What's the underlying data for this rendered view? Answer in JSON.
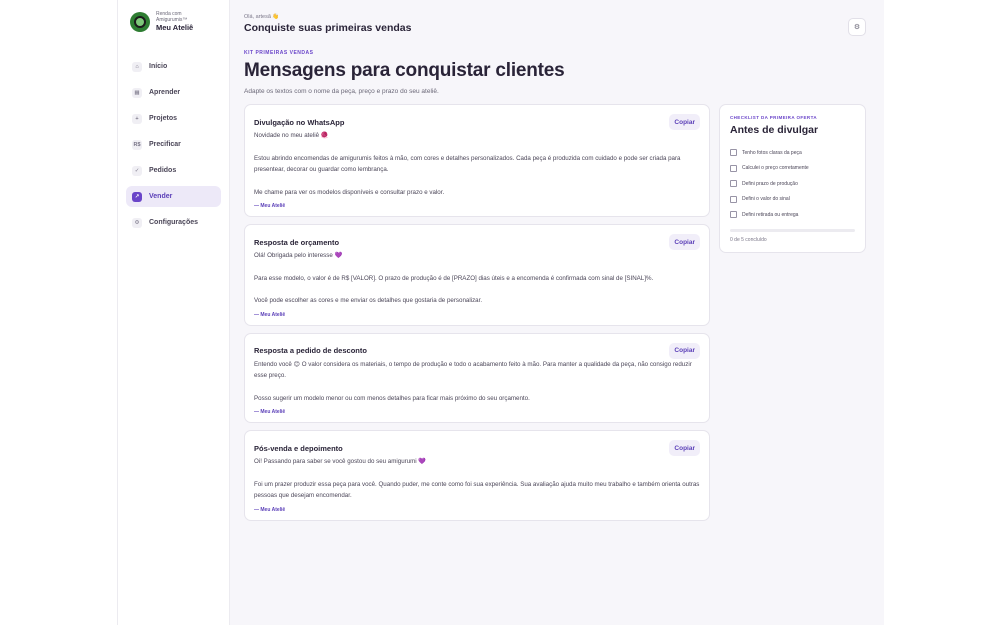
{
  "brand": {
    "line1": "Renda com",
    "line2": "Amigurumis™",
    "name": "Meu Ateliê"
  },
  "nav": [
    {
      "icon": "⌂",
      "label": "Início",
      "active": false
    },
    {
      "icon": "▦",
      "label": "Aprender",
      "active": false
    },
    {
      "icon": "+",
      "label": "Projetos",
      "active": false
    },
    {
      "icon": "R$",
      "label": "Precificar",
      "active": false
    },
    {
      "icon": "✓",
      "label": "Pedidos",
      "active": false
    },
    {
      "icon": "↗",
      "label": "Vender",
      "active": true
    },
    {
      "icon": "⚙",
      "label": "Configurações",
      "active": false
    }
  ],
  "topbar": {
    "greeting": "Olá, artesã 👋",
    "title": "Conquiste suas primeiras vendas",
    "settings_icon": "⚙"
  },
  "page": {
    "eyebrow": "Kit primeiras vendas",
    "title": "Mensagens para conquistar clientes",
    "subtitle": "Adapte os textos com o nome da peça, preço e prazo do seu ateliê."
  },
  "cards": [
    {
      "title": "Divulgação no WhatsApp",
      "copy_label": "Copiar",
      "paragraphs": [
        "Novidade no meu ateliê 🧶",
        "Estou abrindo encomendas de amigurumis feitos à mão, com cores e detalhes personalizados. Cada peça é produzida com cuidado e pode ser criada para presentear, decorar ou guardar como lembrança.",
        "Me chame para ver os modelos disponíveis e consultar prazo e valor."
      ],
      "signature": "— Meu Ateliê"
    },
    {
      "title": "Resposta de orçamento",
      "copy_label": "Copiar",
      "paragraphs": [
        "Olá! Obrigada pelo interesse 💜",
        "Para esse modelo, o valor é de R$ [VALOR]. O prazo de produção é de [PRAZO] dias úteis e a encomenda é confirmada com sinal de [SINAL]%.",
        "Você pode escolher as cores e me enviar os detalhes que gostaria de personalizar."
      ],
      "signature": "— Meu Ateliê"
    },
    {
      "title": "Resposta a pedido de desconto",
      "copy_label": "Copiar",
      "paragraphs": [
        "Entendo você 😊 O valor considera os materiais, o tempo de produção e todo o acabamento feito à mão. Para manter a qualidade da peça, não consigo reduzir esse preço.",
        "Posso sugerir um modelo menor ou com menos detalhes para ficar mais próximo do seu orçamento."
      ],
      "signature": "— Meu Ateliê"
    },
    {
      "title": "Pós-venda e depoimento",
      "copy_label": "Copiar",
      "paragraphs": [
        "Oi! Passando para saber se você gostou do seu amigurumi 💜",
        "Foi um prazer produzir essa peça para você. Quando puder, me conte como foi sua experiência. Sua avaliação ajuda muito meu trabalho e também orienta outras pessoas que desejam encomendar."
      ],
      "signature": "— Meu Ateliê"
    }
  ],
  "checklist": {
    "eyebrow": "Checklist da primeira oferta",
    "title": "Antes de divulgar",
    "items": [
      "Tenho fotos claras da peça",
      "Calculei o preço corretamente",
      "Defini prazo de produção",
      "Defini o valor do sinal",
      "Defini retirada ou entrega"
    ],
    "progress_fraction": 0,
    "progress_text": "0 de 5 concluído"
  },
  "colors": {
    "accent": "#6a45c9",
    "background": "#f7f6fa"
  }
}
